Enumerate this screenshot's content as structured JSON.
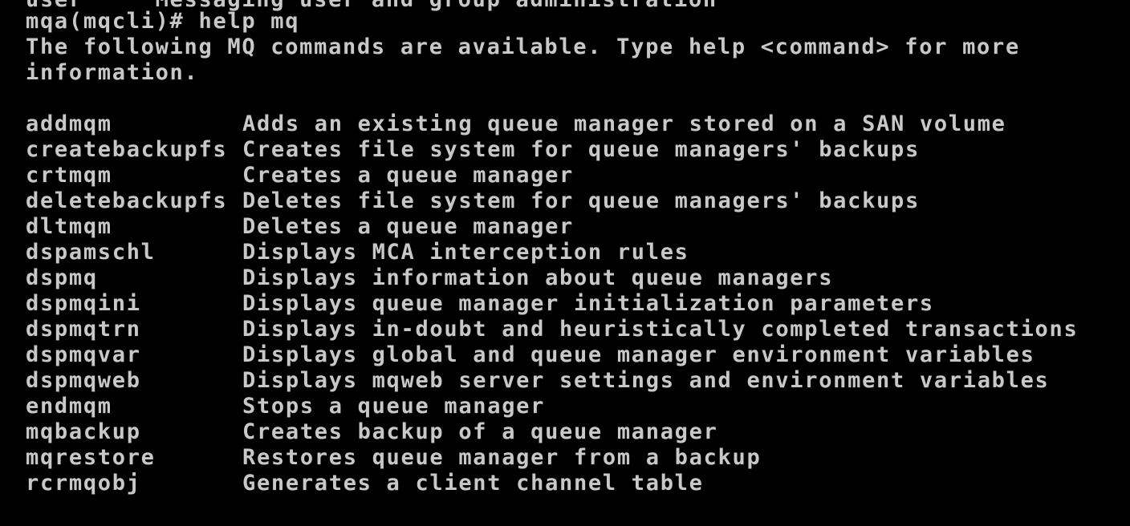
{
  "terminal": {
    "partial_top_line": "user     Messaging user and group administration",
    "prompt": "mqa(mqcli)#",
    "command": "help mq",
    "intro_line_1": "The following MQ commands are available. Type help <command> for more",
    "intro_line_2": "information.",
    "commands": [
      {
        "name": "addmqm",
        "description": "Adds an existing queue manager stored on a SAN volume"
      },
      {
        "name": "createbackupfs",
        "description": "Creates file system for queue managers' backups"
      },
      {
        "name": "crtmqm",
        "description": "Creates a queue manager"
      },
      {
        "name": "deletebackupfs",
        "description": "Deletes file system for queue managers' backups"
      },
      {
        "name": "dltmqm",
        "description": "Deletes a queue manager"
      },
      {
        "name": "dspamschl",
        "description": "Displays MCA interception rules"
      },
      {
        "name": "dspmq",
        "description": "Displays information about queue managers"
      },
      {
        "name": "dspmqini",
        "description": "Displays queue manager initialization parameters"
      },
      {
        "name": "dspmqtrn",
        "description": "Displays in-doubt and heuristically completed transactions"
      },
      {
        "name": "dspmqvar",
        "description": "Displays global and queue manager environment variables"
      },
      {
        "name": "dspmqweb",
        "description": "Displays mqweb server settings and environment variables"
      },
      {
        "name": "endmqm",
        "description": "Stops a queue manager"
      },
      {
        "name": "mqbackup",
        "description": "Creates backup of a queue manager"
      },
      {
        "name": "mqrestore",
        "description": "Restores queue manager from a backup"
      },
      {
        "name": "rcrmqobj",
        "description": "Generates a client channel table"
      }
    ]
  },
  "colors": {
    "background": "#000000",
    "text": "#c8c8c8"
  }
}
